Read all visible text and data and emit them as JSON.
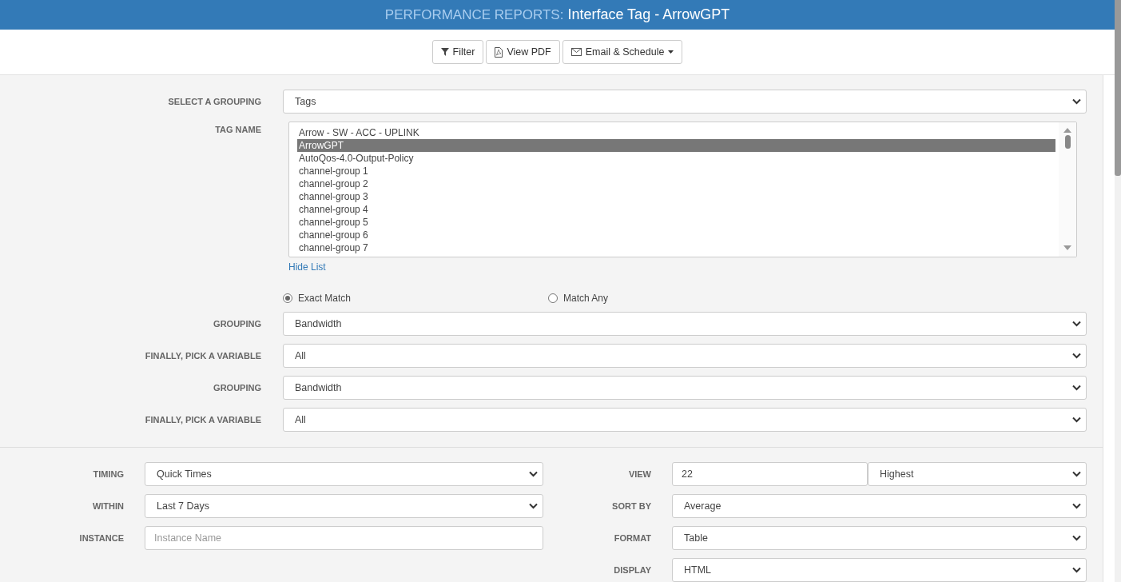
{
  "header": {
    "section": "PERFORMANCE REPORTS:",
    "title": "Interface Tag - ArrowGPT"
  },
  "toolbar": [
    {
      "kind": "filter",
      "label": "Filter",
      "dropdown": false
    },
    {
      "kind": "pdf",
      "label": "View PDF",
      "dropdown": false
    },
    {
      "kind": "email",
      "label": "Email & Schedule",
      "dropdown": true
    }
  ],
  "grouping": {
    "label": "SELECT A GROUPING",
    "value": "Tags"
  },
  "tag_name": {
    "label": "TAG NAME",
    "items": [
      {
        "text": "Arrow - SW - ACC - UPLINK",
        "selected": false
      },
      {
        "text": "ArrowGPT",
        "selected": true
      },
      {
        "text": "AutoQos-4.0-Output-Policy",
        "selected": false
      },
      {
        "text": "channel-group 1",
        "selected": false
      },
      {
        "text": "channel-group 2",
        "selected": false
      },
      {
        "text": "channel-group 3",
        "selected": false
      },
      {
        "text": "channel-group 4",
        "selected": false
      },
      {
        "text": "channel-group 5",
        "selected": false
      },
      {
        "text": "channel-group 6",
        "selected": false
      },
      {
        "text": "channel-group 7",
        "selected": false
      }
    ],
    "link": "Hide List"
  },
  "match": [
    {
      "label": "Exact Match",
      "selected": true
    },
    {
      "label": "Match Any",
      "selected": false
    }
  ],
  "variables": [
    {
      "label": "GROUPING",
      "value": "Bandwidth"
    },
    {
      "label": "FINALLY, PICK A VARIABLE",
      "value": "All"
    },
    {
      "label": "GROUPING",
      "value": "Bandwidth"
    },
    {
      "label": "FINALLY, PICK A VARIABLE",
      "value": "All"
    }
  ],
  "left_options": [
    {
      "label": "TIMING",
      "kind": "select",
      "value": "Quick Times"
    },
    {
      "label": "WITHIN",
      "kind": "select",
      "value": "Last 7 Days"
    },
    {
      "label": "INSTANCE",
      "kind": "input",
      "placeholder": "Instance Name"
    }
  ],
  "right_options": [
    {
      "label": "VIEW",
      "kind": "pair",
      "value": "22",
      "value2": "Highest"
    },
    {
      "label": "SORT BY",
      "kind": "select",
      "value": "Average"
    },
    {
      "label": "FORMAT",
      "kind": "select",
      "value": "Table"
    },
    {
      "label": "DISPLAY",
      "kind": "select",
      "value": "HTML"
    }
  ]
}
